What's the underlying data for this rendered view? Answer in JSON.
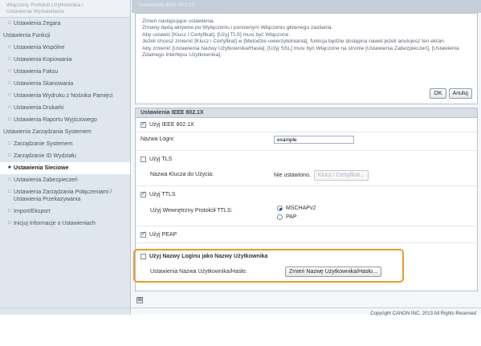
{
  "sidebar": {
    "header_lines": [
      "Włączony Protokół Użytkownika /",
      "Ustawienia Wyświetlania"
    ],
    "items": [
      {
        "label": "Ustawienia Zegara",
        "type": "sub"
      },
      {
        "label": "Ustawienia Funkcji",
        "type": "section"
      },
      {
        "label": "Ustawienia Wspólne",
        "type": "sub"
      },
      {
        "label": "Ustawienia Kopiowania",
        "type": "sub"
      },
      {
        "label": "Ustawienia Faksu",
        "type": "sub"
      },
      {
        "label": "Ustawienia Skanowania",
        "type": "sub"
      },
      {
        "label": "Ustawienia Wydruku z Nośnika Pamięci",
        "type": "sub"
      },
      {
        "label": "Ustawienia Drukarki",
        "type": "sub"
      },
      {
        "label": "Ustawienia Raportu Wyjściowego",
        "type": "sub"
      },
      {
        "label": "Ustawienia Zarządzania Systemem",
        "type": "section"
      },
      {
        "label": "Zarządzanie Systemem",
        "type": "sub"
      },
      {
        "label": "Zarządzanie ID Wydziału",
        "type": "sub"
      },
      {
        "label": "Ustawienia Sieciowe",
        "type": "sub",
        "active": true
      },
      {
        "label": "Ustawienia Zabezpieczeń",
        "type": "sub"
      },
      {
        "label": "Ustawienia Zarządzania Połączeniami / Ustawienia Przekazywania",
        "type": "sub"
      },
      {
        "label": "Import/Eksport",
        "type": "sub"
      },
      {
        "label": "Inicjuj Informacje o Ustawieniach",
        "type": "sub"
      }
    ]
  },
  "main": {
    "top_banner": "Ustawienia IEEE 802.1X",
    "notice": {
      "lines": [
        "Zmień następujące ustawienia.",
        "Zmiany będą aktywne po Wyłączeniu i ponownym Włączeniu głównego zasilania.",
        "Aby ustawić [Klucz i Certyfikat], [Użyj TLS] musi być Włączone.",
        "Jeżeli chcesz zmienić [Klucz i Certyfikat] w [Metodzie uwierzytelniania], funkcja będzie dostępna nawet jeżeli anulujesz ten ekran.",
        "Aby zmienić [Ustawienia Nazwy Użytkownika/Hasła], [Użyj SSL] musi być Włączone na stronie [Ustawienia Zabezpieczeń], [Ustawienia Zdalnego Interfejsu Użytkownika]."
      ],
      "ok_label": "OK",
      "cancel_label": "Anuluj"
    },
    "panel": {
      "title": "Ustawienia IEEE 802.1X",
      "use_8021x_label": "Użyj IEEE 802.1X",
      "login_name_label": "Nazwa Logni:",
      "login_name_value": "example",
      "use_tls_label": "Użyj TLS",
      "key_name_label": "Nazwa Klucza do Użycia:",
      "key_status": "Nie ustawiono.",
      "key_cert_button": "Klucz i Certyfikat...",
      "use_ttls_label": "Użyj TTLS",
      "ttls_protocol_label": "Użyj Wewnętrzny Protokół TTLS:",
      "ttls_options": [
        "MSCHAPv2",
        "PAP"
      ],
      "use_peap_label": "Użyj PEAP",
      "use_login_as_user_label": "Użyj Nazwy Loginu jako Nazwy Użytkownika",
      "user_pass_settings_label": "Ustawienia Nazwa Użytkownika/Hasło:",
      "change_user_pass_button": "Zmień Nazwę Użytkownika/Hasło..."
    },
    "collapse_icon": "⊞",
    "copyright": "Copyright CANON INC. 2013 All Rights Reserved"
  },
  "colors": {
    "highlight": "#ea9a2b",
    "sidebar_bg": "#dfe6ee",
    "accent": "#1c4f8a"
  }
}
